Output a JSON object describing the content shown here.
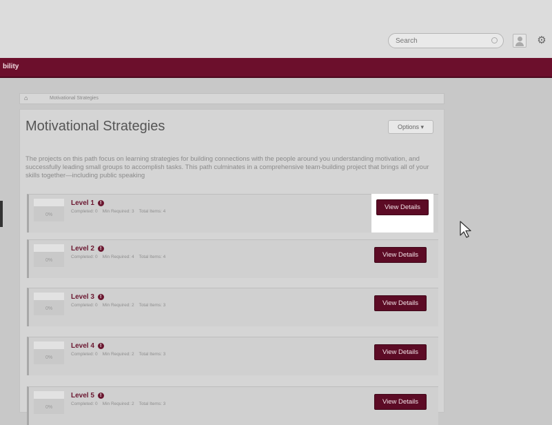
{
  "header": {
    "search_placeholder": "Search",
    "search_icon": "search-icon",
    "user_icon": "user-icon",
    "settings_icon": "gear-icon",
    "settings_glyph": "⚙"
  },
  "nav": {
    "label": "bility"
  },
  "breadcrumb": {
    "home_glyph": "⌂",
    "current": "Motivational Strategies"
  },
  "page": {
    "title": "Motivational Strategies",
    "options_label": "Options ▾",
    "description": "The projects on this path focus on learning strategies for building connections with the people around you understanding motivation, and successfully leading small groups to accomplish tasks. This path culminates in a comprehensive team-building project that brings all of your skills together—including public speaking"
  },
  "levels": [
    {
      "name": "Level 1",
      "progress": "0%",
      "completed": "Completed: 0",
      "min_required": "Min Required: 3",
      "total_items": "Total Items: 4",
      "button": "View Details"
    },
    {
      "name": "Level 2",
      "progress": "0%",
      "completed": "Completed: 0",
      "min_required": "Min Required: 4",
      "total_items": "Total Items: 4",
      "button": "View Details"
    },
    {
      "name": "Level 3",
      "progress": "0%",
      "completed": "Completed: 0",
      "min_required": "Min Required: 2",
      "total_items": "Total Items: 3",
      "button": "View Details"
    },
    {
      "name": "Level 4",
      "progress": "0%",
      "completed": "Completed: 0",
      "min_required": "Min Required: 2",
      "total_items": "Total Items: 3",
      "button": "View Details"
    },
    {
      "name": "Level 5",
      "progress": "0%",
      "completed": "Completed: 0",
      "min_required": "Min Required: 2",
      "total_items": "Total Items: 3",
      "button": "View Details"
    }
  ],
  "colors": {
    "brand": "#6c0f2c",
    "button": "#5c0b25",
    "background": "#c8c8c8"
  }
}
